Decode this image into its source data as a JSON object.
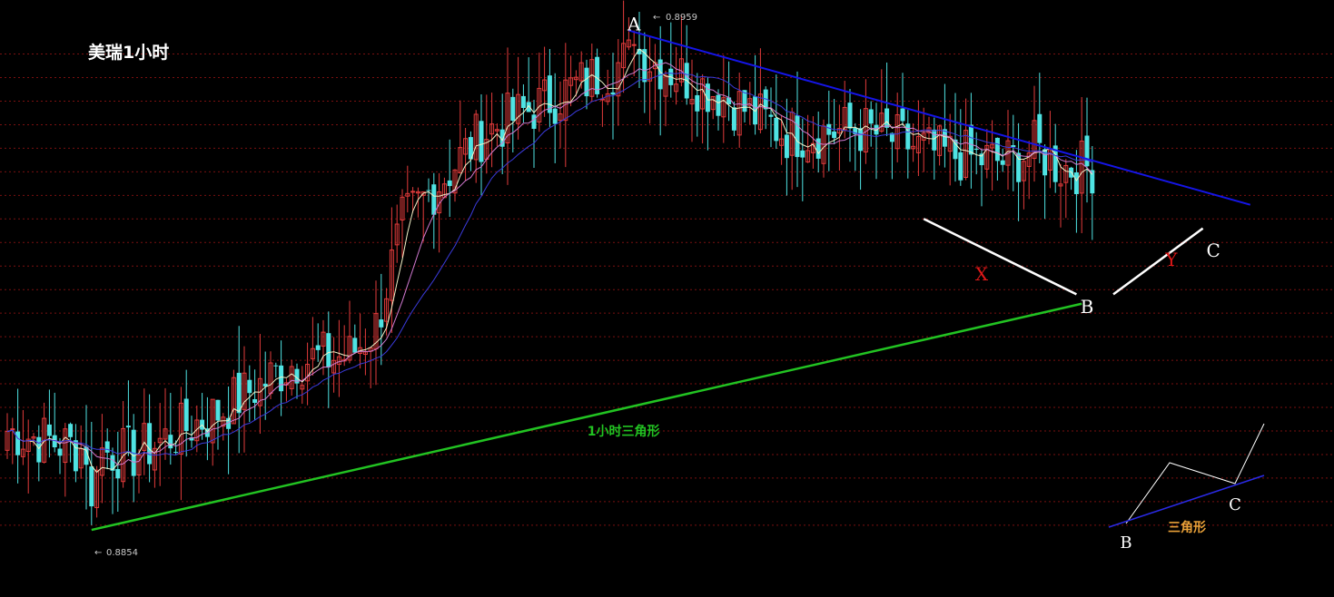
{
  "title": "美瑞1小时",
  "chart_data": {
    "type": "candlestick",
    "instrument": "美瑞",
    "timeframe": "1小时",
    "high_label": "0.8959",
    "low_label": "0.8854",
    "ylim": [
      0.8848,
      0.8962
    ],
    "x_count": 207,
    "gridlines": [
      0.8954,
      0.8949,
      0.8944,
      0.8939,
      0.8934,
      0.8929,
      0.8924,
      0.8919,
      0.8914,
      0.8909,
      0.8904,
      0.8899,
      0.8894,
      0.8889,
      0.8884,
      0.8879,
      0.8874,
      0.8869,
      0.8864,
      0.8859,
      0.8854
    ],
    "price_anchors": [
      [
        0,
        0.8874
      ],
      [
        15,
        0.887
      ],
      [
        24,
        0.8869
      ],
      [
        40,
        0.8878
      ],
      [
        55,
        0.8889
      ],
      [
        65,
        0.889
      ],
      [
        70,
        0.8896
      ],
      [
        75,
        0.8918
      ],
      [
        90,
        0.8937
      ],
      [
        106,
        0.8946
      ],
      [
        120,
        0.8954
      ],
      [
        136,
        0.8945
      ],
      [
        148,
        0.8937
      ],
      [
        162,
        0.8938
      ],
      [
        176,
        0.8933
      ],
      [
        190,
        0.8931
      ],
      [
        195,
        0.8934
      ],
      [
        200,
        0.893
      ],
      [
        207,
        0.893
      ]
    ],
    "annotations": [
      {
        "text": "A",
        "x": 119,
        "price": 0.8959
      },
      {
        "text": "B",
        "x": 205,
        "price": 0.8899
      },
      {
        "text": "C",
        "x": 229,
        "price": 0.8911
      },
      {
        "text": "X",
        "x": 185,
        "price": 0.8906
      },
      {
        "text": "Y",
        "x": 221,
        "price": 0.8909
      },
      {
        "text": "1小时三角形",
        "x": 117,
        "price": 0.8873
      }
    ],
    "trendlines": [
      {
        "name": "upper",
        "from": [
          118,
          0.8959
        ],
        "to": [
          236,
          0.8922
        ],
        "color": "#1515e8"
      },
      {
        "name": "lower",
        "from": [
          16,
          0.8853
        ],
        "to": [
          204,
          0.8901
        ],
        "color": "#22c322"
      },
      {
        "name": "x-leg",
        "from": [
          174,
          0.8919
        ],
        "to": [
          203,
          0.8903
        ],
        "color": "#ffffff"
      },
      {
        "name": "y-leg",
        "from": [
          210,
          0.8903
        ],
        "to": [
          227,
          0.8917
        ],
        "color": "#ffffff"
      }
    ]
  },
  "inset": {
    "label_b": "B",
    "label_c": "C",
    "caption": "三角形"
  },
  "colors": {
    "background": "#000000",
    "up": "#e23b3b",
    "down": "#4fe3e3",
    "grid": "#7a1010",
    "ma_fast": "#f2f2c8",
    "ma_mid": "#d17ad1",
    "ma_slow": "#3b3bdc"
  }
}
